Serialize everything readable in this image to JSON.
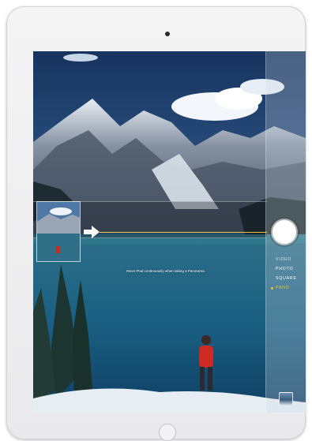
{
  "camera": {
    "pano_hint": "Move iPad continuously when taking a Panorama.",
    "modes": [
      "VIDEO",
      "PHOTO",
      "SQUARE",
      "PANO"
    ],
    "active_mode": "PANO"
  },
  "colors": {
    "accent": "#f2c51d",
    "guide_line": "#e9c84a",
    "bezel": "#f4f4f5"
  }
}
